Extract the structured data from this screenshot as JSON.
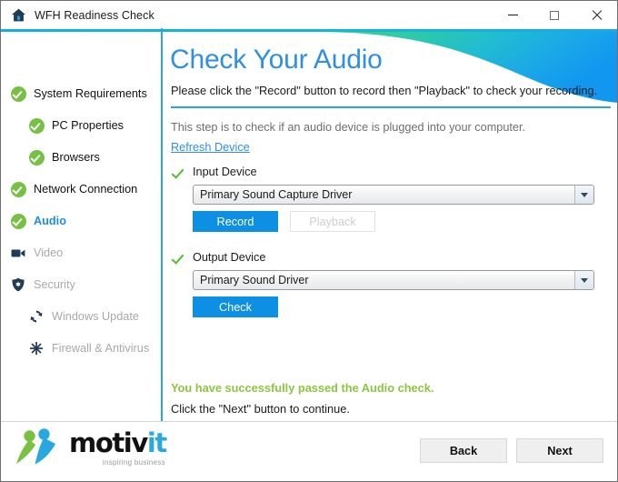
{
  "window": {
    "title": "WFH Readiness Check",
    "home_icon": "home-icon",
    "controls": {
      "minimize": "minimize",
      "maximize": "maximize",
      "close": "close"
    }
  },
  "sidebar": {
    "items": [
      {
        "label": "System Requirements",
        "icon": "check-circle-icon",
        "state": "complete",
        "indent": 0
      },
      {
        "label": "PC Properties",
        "icon": "check-circle-icon",
        "state": "complete",
        "indent": 1
      },
      {
        "label": "Browsers",
        "icon": "check-circle-icon",
        "state": "complete",
        "indent": 1
      },
      {
        "label": "Network Connection",
        "icon": "check-circle-icon",
        "state": "complete",
        "indent": 0
      },
      {
        "label": "Audio",
        "icon": "check-circle-icon",
        "state": "current",
        "indent": 0
      },
      {
        "label": "Video",
        "icon": "video-camera-icon",
        "state": "pending",
        "indent": 0
      },
      {
        "label": "Security",
        "icon": "shield-icon",
        "state": "pending",
        "indent": 0
      },
      {
        "label": "Windows Update",
        "icon": "refresh-icon",
        "state": "pending",
        "indent": 1
      },
      {
        "label": "Firewall & Antivirus",
        "icon": "firewall-icon",
        "state": "pending",
        "indent": 1
      }
    ]
  },
  "main": {
    "title": "Check Your Audio",
    "subtitle": "Please click the \"Record\" button to record then \"Playback\" to check your recording.",
    "step_description": "This step is to check if an audio device is plugged into your computer.",
    "refresh_link": "Refresh Device",
    "input_device": {
      "label": "Input Device",
      "selected": "Primary Sound Capture Driver",
      "record_button": "Record",
      "playback_button": "Playback"
    },
    "output_device": {
      "label": "Output Device",
      "selected": "Primary Sound Driver",
      "check_button": "Check"
    },
    "success_message": "You have successfully passed the Audio check.",
    "continue_hint": "Click the \"Next\" button to continue."
  },
  "footer": {
    "logo": {
      "name_main": "motiv",
      "name_accent": "it",
      "tagline": "inspiring business"
    },
    "back_button": "Back",
    "next_button": "Next"
  },
  "colors": {
    "accent_blue": "#2aa3e0",
    "title_blue": "#2f8fe0",
    "button_blue": "#0d8fe4",
    "success_green": "#8cc63f",
    "check_green": "#76c043",
    "icon_navy": "#1f3b55"
  }
}
